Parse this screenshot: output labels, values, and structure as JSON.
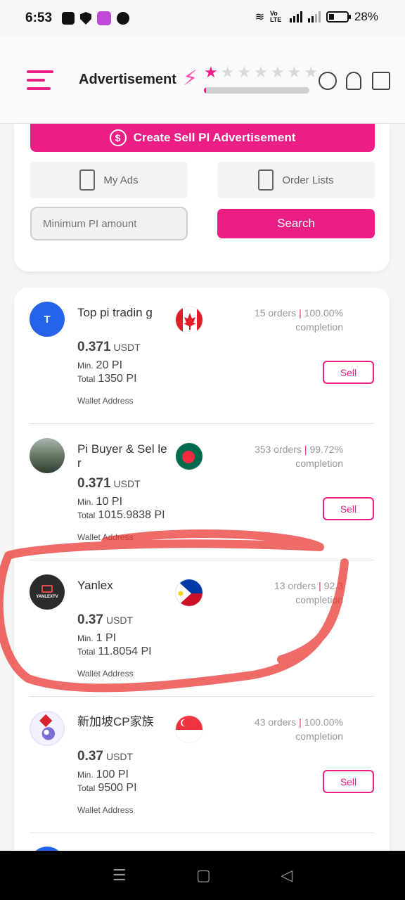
{
  "status_bar": {
    "time": "6:53",
    "network_label": "Vo LTE",
    "battery": "28%"
  },
  "header": {
    "title": "Advertisement",
    "rating_stars_filled": 1,
    "rating_stars_total": 7,
    "level_progress": 0.02,
    "accent_color": "#ea1e84"
  },
  "actions": {
    "create_label": "Create Sell PI Advertisement",
    "my_ads_label": "My Ads",
    "order_lists_label": "Order Lists",
    "min_amount_placeholder": "Minimum PI amount",
    "search_label": "Search"
  },
  "ads": [
    {
      "name": "Top pi tradin g",
      "avatar_text": "T",
      "avatar_color": "#2563eb",
      "flag": "canada",
      "orders": "15 orders",
      "completion_pct": "100.00%",
      "completion_label": "completion",
      "price": "0.371",
      "unit": "USDT",
      "min_label": "Min.",
      "min_value": "20 PI",
      "total_label": "Total",
      "total_value": "1350 PI",
      "wallet_label": "Wallet Address",
      "action": "Sell"
    },
    {
      "name": "Pi Buyer & Sel ler",
      "avatar_text": "",
      "avatar_color": "#5f7360",
      "flag": "bangladesh",
      "orders": "353 orders",
      "completion_pct": "99.72%",
      "completion_label": "completion",
      "price": "0.371",
      "unit": "USDT",
      "min_label": "Min.",
      "min_value": "10 PI",
      "total_label": "Total",
      "total_value": "1015.9838 PI",
      "wallet_label": "Wallet Address",
      "action": "Sell"
    },
    {
      "name": "Yanlex",
      "avatar_text": "YANLEXTV",
      "avatar_color": "#2b2b2b",
      "flag": "philippines",
      "orders": "13 orders",
      "completion_pct": "92.3",
      "completion_label": "completion",
      "price": "0.37",
      "unit": "USDT",
      "min_label": "Min.",
      "min_value": "1 PI",
      "total_label": "Total",
      "total_value": "11.8054 PI",
      "wallet_label": "Wallet Address",
      "action": ""
    },
    {
      "name": "新加坡CP家族",
      "avatar_text": "",
      "avatar_color": "#7b6fd6",
      "flag": "singapore",
      "orders": "43 orders",
      "completion_pct": "100.00%",
      "completion_label": "completion",
      "price": "0.37",
      "unit": "USDT",
      "min_label": "Min.",
      "min_value": "100 PI",
      "total_label": "Total",
      "total_value": "9500 PI",
      "wallet_label": "Wallet Address",
      "action": "Sell"
    }
  ],
  "nav": {
    "menu_icon": "☰",
    "home_icon": "▢",
    "back_icon": "◁"
  }
}
